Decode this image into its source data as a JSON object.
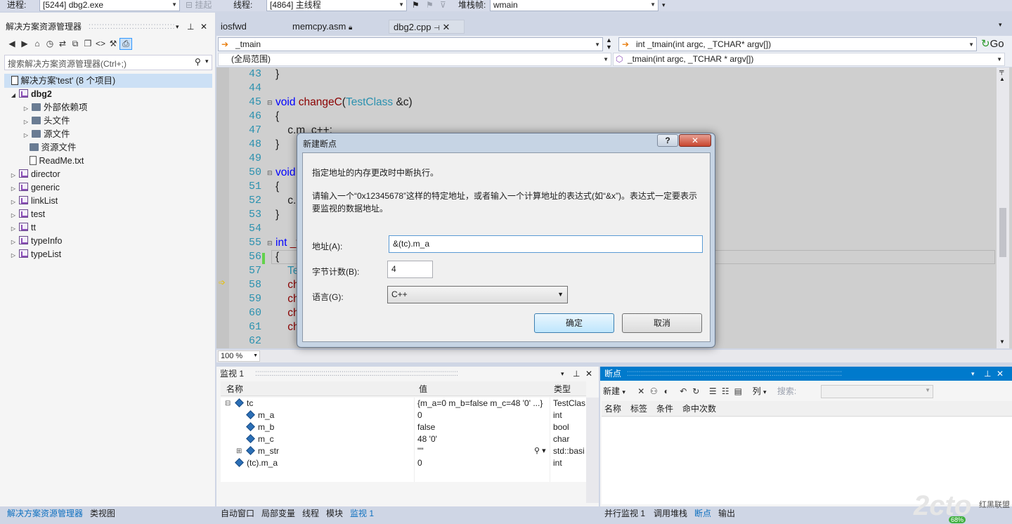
{
  "topbar": {
    "process_label": "进程:",
    "process_value": "[5244] dbg2.exe",
    "suspend_label": "挂起",
    "thread_label": "线程:",
    "thread_value": "[4864] 主线程",
    "stackframe_label": "堆栈帧:",
    "stackframe_value": "wmain"
  },
  "solution_explorer": {
    "title": "解决方案资源管理器",
    "search_placeholder": "搜索解决方案资源管理器(Ctrl+;)",
    "items": [
      {
        "label": "解决方案'test' (8 个项目)"
      },
      {
        "label": "dbg2"
      },
      {
        "label": "外部依赖项"
      },
      {
        "label": "头文件"
      },
      {
        "label": "源文件"
      },
      {
        "label": "资源文件"
      },
      {
        "label": "ReadMe.txt"
      },
      {
        "label": "director"
      },
      {
        "label": "generic"
      },
      {
        "label": "linkList"
      },
      {
        "label": "test"
      },
      {
        "label": "tt"
      },
      {
        "label": "typeInfo"
      },
      {
        "label": "typeList"
      }
    ],
    "bottom_tabs": [
      "解决方案资源管理器",
      "类视图"
    ]
  },
  "editor": {
    "tabs": [
      {
        "label": "iosfwd"
      },
      {
        "label": "memcpy.asm"
      },
      {
        "label": "dbg2.cpp"
      }
    ],
    "nav_left": "_tmain",
    "nav_right": "int _tmain(int argc, _TCHAR* argv[])",
    "go_label": "Go",
    "scope_left": "(全局范围)",
    "scope_right": "_tmain(int argc, _TCHAR * argv[])",
    "zoom": "100 %",
    "lines": [
      {
        "n": "43",
        "parts": [
          {
            "t": "}",
            "c": "pl"
          }
        ]
      },
      {
        "n": "44",
        "parts": []
      },
      {
        "n": "45",
        "parts": [
          {
            "t": "void ",
            "c": "kw"
          },
          {
            "t": "changeC",
            "c": "fn"
          },
          {
            "t": "(",
            "c": "pl"
          },
          {
            "t": "TestClass",
            "c": "ty"
          },
          {
            "t": " &c)",
            "c": "pl"
          }
        ]
      },
      {
        "n": "46",
        "parts": [
          {
            "t": "{",
            "c": "pl"
          }
        ]
      },
      {
        "n": "47",
        "parts": [
          {
            "t": "    c.m_c++;",
            "c": "pl"
          }
        ]
      },
      {
        "n": "48",
        "parts": [
          {
            "t": "}",
            "c": "pl"
          }
        ]
      },
      {
        "n": "49",
        "parts": []
      },
      {
        "n": "50",
        "parts": [
          {
            "t": "void",
            "c": "kw"
          }
        ]
      },
      {
        "n": "51",
        "parts": [
          {
            "t": "{",
            "c": "pl"
          }
        ]
      },
      {
        "n": "52",
        "parts": [
          {
            "t": "    c.i",
            "c": "pl"
          }
        ]
      },
      {
        "n": "53",
        "parts": [
          {
            "t": "}",
            "c": "pl"
          }
        ]
      },
      {
        "n": "54",
        "parts": []
      },
      {
        "n": "55",
        "parts": [
          {
            "t": "int ",
            "c": "kw"
          },
          {
            "t": "_t",
            "c": "fn"
          }
        ]
      },
      {
        "n": "56",
        "parts": [
          {
            "t": "{",
            "c": "pl"
          }
        ]
      },
      {
        "n": "57",
        "parts": [
          {
            "t": "    Te",
            "c": "ty"
          }
        ]
      },
      {
        "n": "58",
        "parts": [
          {
            "t": "    ch",
            "c": "fn"
          }
        ]
      },
      {
        "n": "59",
        "parts": [
          {
            "t": "    ch",
            "c": "fn"
          }
        ]
      },
      {
        "n": "60",
        "parts": [
          {
            "t": "    ch",
            "c": "fn"
          }
        ]
      },
      {
        "n": "61",
        "parts": [
          {
            "t": "    ch",
            "c": "fn"
          }
        ]
      },
      {
        "n": "62",
        "parts": []
      }
    ]
  },
  "watch": {
    "title": "监视 1",
    "columns": [
      "名称",
      "值",
      "类型"
    ],
    "rows": [
      {
        "expander": "⊟",
        "name": "tc",
        "value": "{m_a=0 m_b=false m_c=48 '0' ...}",
        "type": "TestClas"
      },
      {
        "expander": "",
        "name": "m_a",
        "value": "0",
        "type": "int"
      },
      {
        "expander": "",
        "name": "m_b",
        "value": "false",
        "type": "bool"
      },
      {
        "expander": "",
        "name": "m_c",
        "value": "48 '0'",
        "type": "char"
      },
      {
        "expander": "⊞",
        "name": "m_str",
        "value": "\"\"",
        "type": "std::basi"
      },
      {
        "expander": "",
        "name": "(tc).m_a",
        "value": "0",
        "type": "int"
      }
    ],
    "bottom_tabs": [
      "自动窗口",
      "局部变量",
      "线程",
      "模块",
      "监视 1"
    ]
  },
  "breakpoints": {
    "title": "断点",
    "new_label": "新建",
    "columns_label": "列",
    "search_label": "搜索:",
    "columns": [
      "名称",
      "标签",
      "条件",
      "命中次数"
    ],
    "bottom_tabs": [
      "并行监视 1",
      "调用堆栈",
      "断点",
      "输出"
    ]
  },
  "dialog": {
    "title": "新建断点",
    "help_glyph": "?",
    "close_glyph": "✕",
    "desc1": "指定地址的内存更改时中断执行。",
    "desc2": "请输入一个“0x12345678”这样的特定地址，或者输入一个计算地址的表达式(如“&x”)。表达式一定要表示要监视的数据地址。",
    "address_label": "地址(A):",
    "address_value": "&(tc).m_a",
    "bytes_label": "字节计数(B):",
    "bytes_value": "4",
    "lang_label": "语言(G):",
    "lang_value": "C++",
    "ok_label": "确定",
    "cancel_label": "取消"
  },
  "watermark": {
    "text": "2cto",
    "sub": "红黑联盟",
    "badge": "68%"
  },
  "colors": {
    "accent": "#007acc",
    "panel_bg": "#f5f5f5",
    "editor_bg": "#cfcfcf",
    "dialog_frame": "#c6d0dd",
    "watch_link": "#0e70c0"
  }
}
